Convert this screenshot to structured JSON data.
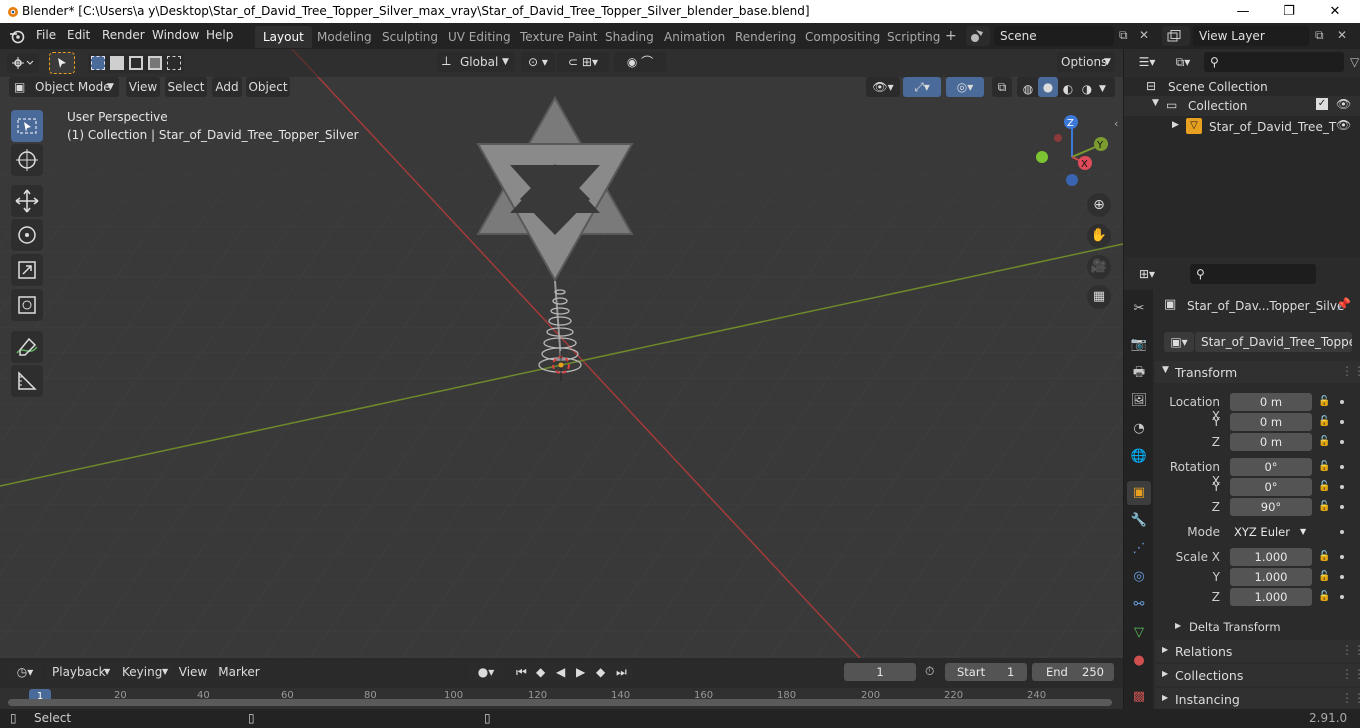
{
  "window": {
    "title": "Blender* [C:\\Users\\a y\\Desktop\\Star_of_David_Tree_Topper_Silver_max_vray\\Star_of_David_Tree_Topper_Silver_blender_base.blend]",
    "minimize": "—",
    "maximize": "❐",
    "close": "✕"
  },
  "menu": [
    "File",
    "Edit",
    "Render",
    "Window",
    "Help"
  ],
  "workspaces": [
    "Layout",
    "Modeling",
    "Sculpting",
    "UV Editing",
    "Texture Paint",
    "Shading",
    "Animation",
    "Rendering",
    "Compositing",
    "Scripting"
  ],
  "active_workspace": "Layout",
  "scene": {
    "label": "Scene",
    "view_layer": "View Layer"
  },
  "viewport": {
    "orientation": "Global",
    "options": "Options",
    "mode": "Object Mode",
    "header_menus": [
      "View",
      "Select",
      "Add",
      "Object"
    ],
    "overlay_line1": "User Perspective",
    "overlay_line2": "(1) Collection | Star_of_David_Tree_Topper_Silver",
    "gizmo": {
      "x": "X",
      "y": "Y",
      "z": "Z"
    }
  },
  "outliner": {
    "scene_collection": "Scene Collection",
    "collection": "Collection",
    "object": "Star_of_David_Tree_T"
  },
  "properties": {
    "object_name": "Star_of_Dav...Topper_Silve",
    "data_name": "Star_of_David_Tree_Topper_...",
    "transform_header": "Transform",
    "location": {
      "label": "Location X",
      "x": "0 m",
      "y": "0 m",
      "z": "0 m"
    },
    "rotation": {
      "label": "Rotation X",
      "x": "0°",
      "y": "0°",
      "z": "90°"
    },
    "mode_label": "Mode",
    "mode_value": "XYZ Euler",
    "scale": {
      "label": "Scale X",
      "x": "1.000",
      "y": "1.000",
      "z": "1.000"
    },
    "axis_y": "Y",
    "axis_z": "Z",
    "delta": "Delta Transform",
    "relations": "Relations",
    "collections": "Collections",
    "instancing": "Instancing"
  },
  "timeline": {
    "menus": [
      "Playback",
      "Keying",
      "View",
      "Marker"
    ],
    "current_frame": "1",
    "start_label": "Start",
    "start": "1",
    "end_label": "End",
    "end": "250",
    "ruler": [
      "1",
      "20",
      "40",
      "60",
      "80",
      "100",
      "120",
      "140",
      "160",
      "180",
      "200",
      "220",
      "240"
    ]
  },
  "status": {
    "select": "Select",
    "version": "2.91.0"
  },
  "colors": {
    "accent": "#4a6a99",
    "x_axis": "#c44b4b",
    "y_axis": "#7c9c31",
    "z_axis": "#3c78d8"
  }
}
